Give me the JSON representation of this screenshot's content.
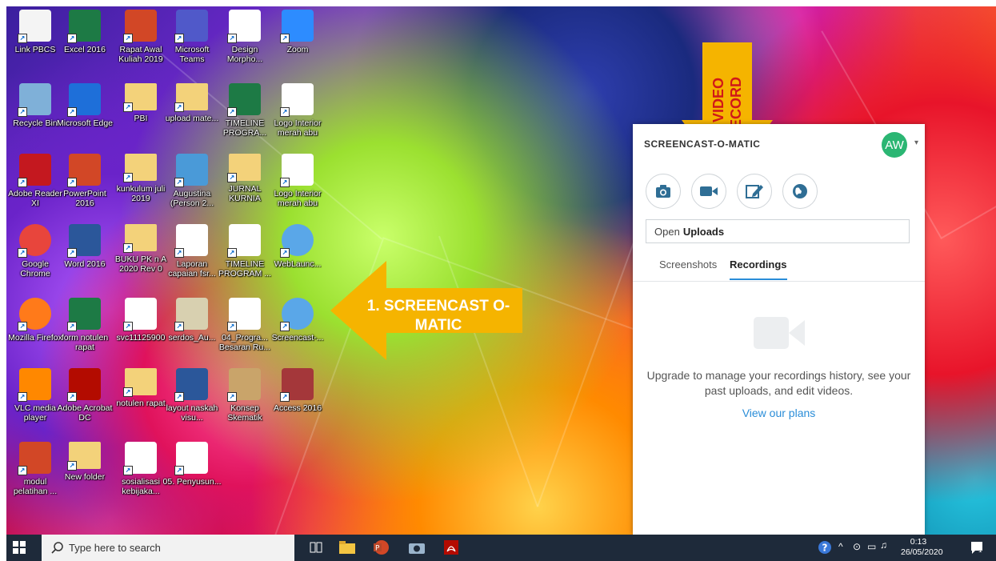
{
  "desktop": {
    "icons": [
      {
        "label": "Link PBCS",
        "icon": "text-file-icon",
        "color": "#f4f4f4"
      },
      {
        "label": "Excel 2016",
        "icon": "excel-icon",
        "color": "#1d7a45"
      },
      {
        "label": "Rapat Awal Kuliah 2019",
        "icon": "powerpoint-icon",
        "color": "#d24726"
      },
      {
        "label": "Microsoft Teams",
        "icon": "teams-icon",
        "color": "#5059c9"
      },
      {
        "label": "Design Morpho...",
        "icon": "pdf-thumbnail-icon",
        "color": "#ffffff"
      },
      {
        "label": "Zoom",
        "icon": "zoom-icon",
        "color": "#2d8cff"
      },
      {
        "label": "Recycle Bin",
        "icon": "recycle-bin-icon",
        "color": "#7fb0d8"
      },
      {
        "label": "Microsoft Edge",
        "icon": "edge-icon",
        "color": "#1e6fd9"
      },
      {
        "label": "PBI",
        "icon": "folder-icon",
        "color": "#f3d27a"
      },
      {
        "label": "upload mate...",
        "icon": "folder-icon",
        "color": "#f3d27a"
      },
      {
        "label": "TIMELINE PROGRA...",
        "icon": "excel-file-icon",
        "color": "#1d7a45"
      },
      {
        "label": "Logo Interior merah abu",
        "icon": "pdf-file-icon",
        "color": "#ffffff"
      },
      {
        "label": "Adobe Reader XI",
        "icon": "acrobat-reader-icon",
        "color": "#c4181f"
      },
      {
        "label": "PowerPoint 2016",
        "icon": "powerpoint-icon",
        "color": "#d24726"
      },
      {
        "label": "kunkulum juli 2019",
        "icon": "folder-icon",
        "color": "#f3d27a"
      },
      {
        "label": "Augustina (Person 2...",
        "icon": "contact-icon",
        "color": "#4a9ad8"
      },
      {
        "label": "JURNAL KURNIA",
        "icon": "folder-icon",
        "color": "#f3d27a"
      },
      {
        "label": "Logo Interior merah abu",
        "icon": "image-thumbnail-icon",
        "color": "#ffffff"
      },
      {
        "label": "Google Chrome",
        "icon": "chrome-icon",
        "color": "#e8453c"
      },
      {
        "label": "Word 2016",
        "icon": "word-icon",
        "color": "#2b579a"
      },
      {
        "label": "BUKU PK n A 2020 Rev 0",
        "icon": "folder-icon",
        "color": "#f3d27a"
      },
      {
        "label": "Laporan capaian fsr...",
        "icon": "powerpoint-file-icon",
        "color": "#ffffff"
      },
      {
        "label": "TIMELINE PROGRAM ...",
        "icon": "pdf-file-icon",
        "color": "#ffffff"
      },
      {
        "label": "WebLaunc...",
        "icon": "screencast-o-matic-icon",
        "color": "#5aa7e8"
      },
      {
        "label": "Mozilla Firefox",
        "icon": "firefox-icon",
        "color": "#ff7a1a"
      },
      {
        "label": "form notulen rapat",
        "icon": "excel-file-icon",
        "color": "#1d7a45"
      },
      {
        "label": "svc11125900",
        "icon": "file-icon",
        "color": "#ffffff"
      },
      {
        "label": "serdos_Au...",
        "icon": "image-thumbnail-icon",
        "color": "#d8d0b0"
      },
      {
        "label": "04_Progra... Besaran Ru...",
        "icon": "image-thumbnail-icon",
        "color": "#ffffff"
      },
      {
        "label": "Screencast-...",
        "icon": "screencast-o-matic-icon",
        "color": "#5aa7e8"
      },
      {
        "label": "VLC media player",
        "icon": "vlc-icon",
        "color": "#ff8800"
      },
      {
        "label": "Adobe Acrobat DC",
        "icon": "acrobat-dc-icon",
        "color": "#b30b00"
      },
      {
        "label": "notulen rapat",
        "icon": "folder-icon",
        "color": "#f3d27a"
      },
      {
        "label": "layout naskah visu...",
        "icon": "word-file-icon",
        "color": "#2b579a"
      },
      {
        "label": "Konsep Skematik",
        "icon": "image-thumbnail-icon",
        "color": "#c9a46a"
      },
      {
        "label": "Access 2016",
        "icon": "access-icon",
        "color": "#a4373a"
      },
      {
        "label": "modul pelatihan ...",
        "icon": "powerpoint-file-icon",
        "color": "#d24726"
      },
      {
        "label": "New folder",
        "icon": "folder-icon",
        "color": "#f3d27a"
      },
      {
        "label": "sosialisasi kebijaka...",
        "icon": "powerpoint-file-icon",
        "color": "#ffffff"
      },
      {
        "label": "05. Penyusun...",
        "icon": "powerpoint-file-icon",
        "color": "#ffffff"
      }
    ]
  },
  "callouts": {
    "screencast": "1. SCREENCAST O-MATIC",
    "video": "2. VIDEO RECORD",
    "arrow_color": "#f5b400"
  },
  "panel": {
    "title": "SCREENCAST-O-MATIC",
    "avatar": "AW",
    "tools": [
      "camera-icon",
      "video-camera-icon",
      "edit-image-icon",
      "globe-icon"
    ],
    "uploads_prefix": "Open",
    "uploads_bold": "Uploads",
    "tabs": [
      "Screenshots",
      "Recordings"
    ],
    "empty_message": "Upgrade to manage your recordings history, see your past uploads, and edit videos.",
    "plans_link": "View our plans",
    "accent": "#2a8dd8",
    "avatar_color": "#2bb673"
  },
  "taskbar": {
    "search_placeholder": "Type here to search",
    "time": "0:13",
    "date": "26/05/2020",
    "notification_count": "1"
  }
}
